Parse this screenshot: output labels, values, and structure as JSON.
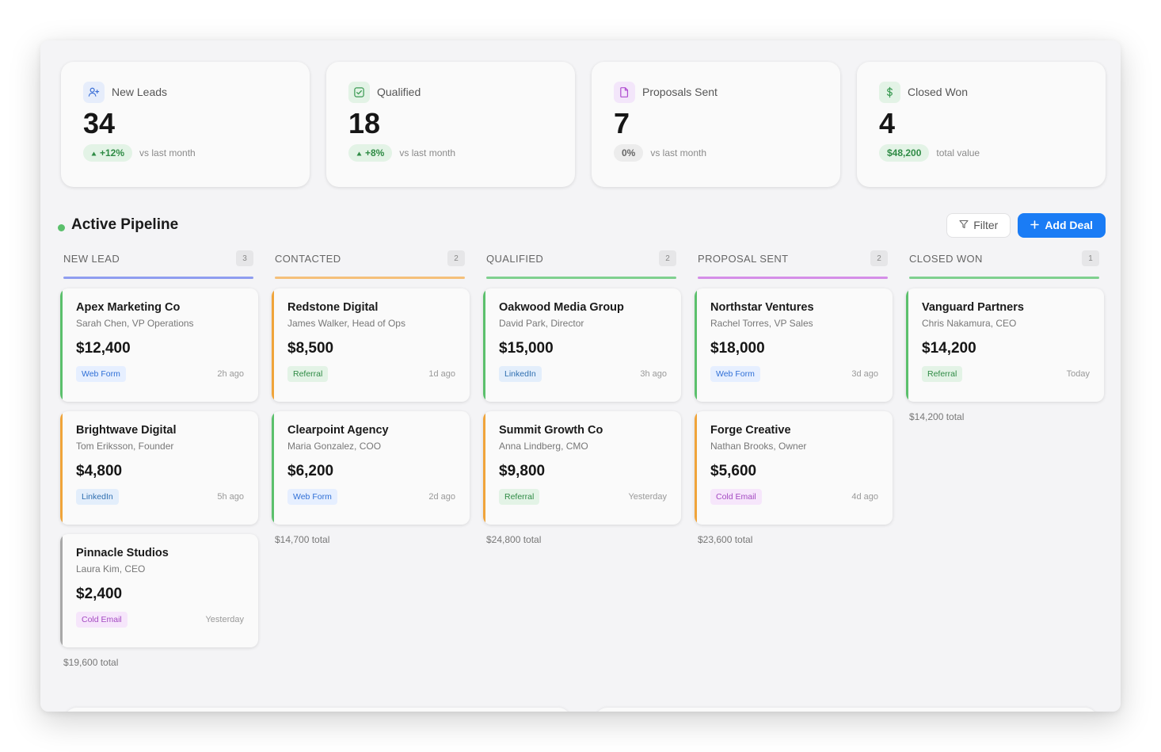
{
  "stats": [
    {
      "label": "New Leads",
      "value": "34",
      "pill": "+12%",
      "pill_style": "green",
      "show_arrow": true,
      "foot": "vs last month",
      "icon": "user-plus-icon",
      "icon_color": "#3b6fd6",
      "icon_bg": "#e6edfb"
    },
    {
      "label": "Qualified",
      "value": "18",
      "pill": "+8%",
      "pill_style": "green",
      "show_arrow": true,
      "foot": "vs last month",
      "icon": "check-square-icon",
      "icon_color": "#3a9a52",
      "icon_bg": "#e3f3e6"
    },
    {
      "label": "Proposals Sent",
      "value": "7",
      "pill": "0%",
      "pill_style": "gray",
      "show_arrow": false,
      "foot": "vs last month",
      "icon": "document-icon",
      "icon_color": "#b04ed0",
      "icon_bg": "#f3e6fa"
    },
    {
      "label": "Closed Won",
      "value": "4",
      "pill": "$48,200",
      "pill_style": "green",
      "show_arrow": false,
      "foot": "total value",
      "icon": "dollar-icon",
      "icon_color": "#3a9a52",
      "icon_bg": "#e3f3e6"
    }
  ],
  "pipeline": {
    "title": "Active Pipeline",
    "filter_label": "Filter",
    "add_label": "Add Deal"
  },
  "columns": [
    {
      "title": "NEW LEAD",
      "count": "3",
      "color": "#8f9df0",
      "total": "$19,600 total",
      "cards": [
        {
          "name": "Apex Marketing Co",
          "contact": "Sarah Chen, VP Operations",
          "amount": "$12,400",
          "tag": "Web Form",
          "tag_style": "webform",
          "time": "2h ago",
          "edge": "#5bc06c"
        },
        {
          "name": "Brightwave Digital",
          "contact": "Tom Eriksson, Founder",
          "amount": "$4,800",
          "tag": "LinkedIn",
          "tag_style": "linkedin",
          "time": "5h ago",
          "edge": "#f0a43a"
        },
        {
          "name": "Pinnacle Studios",
          "contact": "Laura Kim, CEO",
          "amount": "$2,400",
          "tag": "Cold Email",
          "tag_style": "coldemail",
          "time": "Yesterday",
          "edge": "#a8a8a8"
        }
      ]
    },
    {
      "title": "CONTACTED",
      "count": "2",
      "color": "#f5c07a",
      "total": "$14,700 total",
      "cards": [
        {
          "name": "Redstone Digital",
          "contact": "James Walker, Head of Ops",
          "amount": "$8,500",
          "tag": "Referral",
          "tag_style": "referral",
          "time": "1d ago",
          "edge": "#f0a43a"
        },
        {
          "name": "Clearpoint Agency",
          "contact": "Maria Gonzalez, COO",
          "amount": "$6,200",
          "tag": "Web Form",
          "tag_style": "webform",
          "time": "2d ago",
          "edge": "#5bc06c"
        }
      ]
    },
    {
      "title": "QUALIFIED",
      "count": "2",
      "color": "#7fd08f",
      "total": "$24,800 total",
      "cards": [
        {
          "name": "Oakwood Media Group",
          "contact": "David Park, Director",
          "amount": "$15,000",
          "tag": "LinkedIn",
          "tag_style": "linkedin",
          "time": "3h ago",
          "edge": "#5bc06c"
        },
        {
          "name": "Summit Growth Co",
          "contact": "Anna Lindberg, CMO",
          "amount": "$9,800",
          "tag": "Referral",
          "tag_style": "referral",
          "time": "Yesterday",
          "edge": "#f0a43a"
        }
      ]
    },
    {
      "title": "PROPOSAL SENT",
      "count": "2",
      "color": "#d58ee8",
      "total": "$23,600 total",
      "cards": [
        {
          "name": "Northstar Ventures",
          "contact": "Rachel Torres, VP Sales",
          "amount": "$18,000",
          "tag": "Web Form",
          "tag_style": "webform",
          "time": "3d ago",
          "edge": "#5bc06c"
        },
        {
          "name": "Forge Creative",
          "contact": "Nathan Brooks, Owner",
          "amount": "$5,600",
          "tag": "Cold Email",
          "tag_style": "coldemail",
          "time": "4d ago",
          "edge": "#f0a43a"
        }
      ]
    },
    {
      "title": "CLOSED WON",
      "count": "1",
      "color": "#7fd08f",
      "total": "$14,200 total",
      "cards": [
        {
          "name": "Vanguard Partners",
          "contact": "Chris Nakamura, CEO",
          "amount": "$14,200",
          "tag": "Referral",
          "tag_style": "referral",
          "time": "Today",
          "edge": "#5bc06c"
        }
      ]
    }
  ]
}
